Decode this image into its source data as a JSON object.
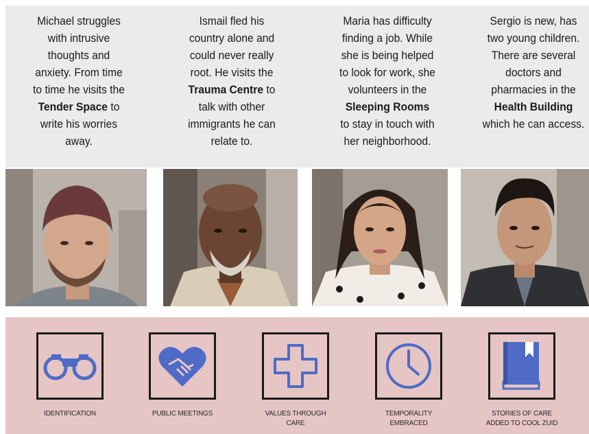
{
  "stories": [
    {
      "person": "Michael",
      "lines": [
        "Michael struggles",
        "with intrusive",
        "thoughts and",
        "anxiety. From time",
        "to time he visits the",
        "",
        "write his worries",
        "away."
      ],
      "emphasis": "Tender Space",
      "emphasis_line_suffix": " to"
    },
    {
      "person": "Ismail",
      "lines": [
        "Ismail fled his",
        "country alone and",
        "could never really",
        "root. He visits the",
        "",
        "talk with other",
        "immigrants he can",
        "relate to."
      ],
      "emphasis": "Trauma Centre",
      "emphasis_line_suffix": " to"
    },
    {
      "person": "Maria",
      "lines": [
        "Maria has difficulty",
        "finding a job. While",
        "she is being helped",
        "to look for work, she",
        "volunteers in the",
        "",
        "to stay in touch with",
        "her neighborhood."
      ],
      "emphasis": "Sleeping Rooms",
      "emphasis_line_suffix": ""
    },
    {
      "person": "Sergio",
      "lines": [
        "Sergio is new, has",
        "two young children.",
        "There are several",
        "doctors and",
        "pharmacies in the",
        "",
        "which he can access."
      ],
      "emphasis": "Health Building",
      "emphasis_line_suffix": ""
    }
  ],
  "values": [
    {
      "icon": "binoculars-icon",
      "label_lines": [
        "IDENTIFICATION"
      ]
    },
    {
      "icon": "heart-handshake-icon",
      "label_lines": [
        "PUBLIC MEETINGS"
      ]
    },
    {
      "icon": "cross-icon",
      "label_lines": [
        "VALUES THROUGH",
        "CARE"
      ]
    },
    {
      "icon": "clock-icon",
      "label_lines": [
        "TEMPORALITY",
        "EMBRACED"
      ]
    },
    {
      "icon": "book-icon",
      "label_lines": [
        "STORIES OF CARE",
        "ADDED TO COOL ZUID"
      ]
    }
  ],
  "colors": {
    "top_band": "#ebebeb",
    "bottom_band": "#e6c5c5",
    "icon_blue": "#4f6bc6",
    "box_border": "#1b1b1b"
  }
}
